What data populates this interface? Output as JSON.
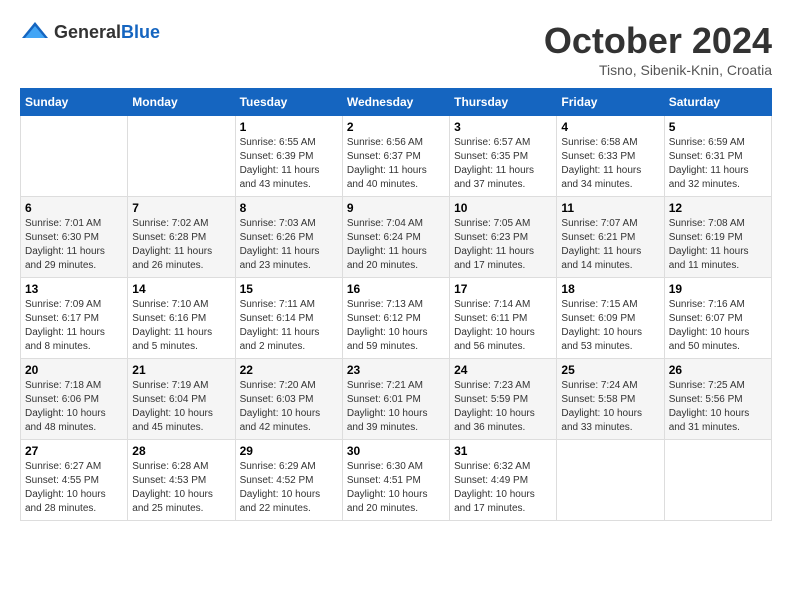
{
  "header": {
    "logo_general": "General",
    "logo_blue": "Blue",
    "month_year": "October 2024",
    "location": "Tisno, Sibenik-Knin, Croatia"
  },
  "weekdays": [
    "Sunday",
    "Monday",
    "Tuesday",
    "Wednesday",
    "Thursday",
    "Friday",
    "Saturday"
  ],
  "weeks": [
    [
      {
        "day": "",
        "info": ""
      },
      {
        "day": "",
        "info": ""
      },
      {
        "day": "1",
        "info": "Sunrise: 6:55 AM\nSunset: 6:39 PM\nDaylight: 11 hours and 43 minutes."
      },
      {
        "day": "2",
        "info": "Sunrise: 6:56 AM\nSunset: 6:37 PM\nDaylight: 11 hours and 40 minutes."
      },
      {
        "day": "3",
        "info": "Sunrise: 6:57 AM\nSunset: 6:35 PM\nDaylight: 11 hours and 37 minutes."
      },
      {
        "day": "4",
        "info": "Sunrise: 6:58 AM\nSunset: 6:33 PM\nDaylight: 11 hours and 34 minutes."
      },
      {
        "day": "5",
        "info": "Sunrise: 6:59 AM\nSunset: 6:31 PM\nDaylight: 11 hours and 32 minutes."
      }
    ],
    [
      {
        "day": "6",
        "info": "Sunrise: 7:01 AM\nSunset: 6:30 PM\nDaylight: 11 hours and 29 minutes."
      },
      {
        "day": "7",
        "info": "Sunrise: 7:02 AM\nSunset: 6:28 PM\nDaylight: 11 hours and 26 minutes."
      },
      {
        "day": "8",
        "info": "Sunrise: 7:03 AM\nSunset: 6:26 PM\nDaylight: 11 hours and 23 minutes."
      },
      {
        "day": "9",
        "info": "Sunrise: 7:04 AM\nSunset: 6:24 PM\nDaylight: 11 hours and 20 minutes."
      },
      {
        "day": "10",
        "info": "Sunrise: 7:05 AM\nSunset: 6:23 PM\nDaylight: 11 hours and 17 minutes."
      },
      {
        "day": "11",
        "info": "Sunrise: 7:07 AM\nSunset: 6:21 PM\nDaylight: 11 hours and 14 minutes."
      },
      {
        "day": "12",
        "info": "Sunrise: 7:08 AM\nSunset: 6:19 PM\nDaylight: 11 hours and 11 minutes."
      }
    ],
    [
      {
        "day": "13",
        "info": "Sunrise: 7:09 AM\nSunset: 6:17 PM\nDaylight: 11 hours and 8 minutes."
      },
      {
        "day": "14",
        "info": "Sunrise: 7:10 AM\nSunset: 6:16 PM\nDaylight: 11 hours and 5 minutes."
      },
      {
        "day": "15",
        "info": "Sunrise: 7:11 AM\nSunset: 6:14 PM\nDaylight: 11 hours and 2 minutes."
      },
      {
        "day": "16",
        "info": "Sunrise: 7:13 AM\nSunset: 6:12 PM\nDaylight: 10 hours and 59 minutes."
      },
      {
        "day": "17",
        "info": "Sunrise: 7:14 AM\nSunset: 6:11 PM\nDaylight: 10 hours and 56 minutes."
      },
      {
        "day": "18",
        "info": "Sunrise: 7:15 AM\nSunset: 6:09 PM\nDaylight: 10 hours and 53 minutes."
      },
      {
        "day": "19",
        "info": "Sunrise: 7:16 AM\nSunset: 6:07 PM\nDaylight: 10 hours and 50 minutes."
      }
    ],
    [
      {
        "day": "20",
        "info": "Sunrise: 7:18 AM\nSunset: 6:06 PM\nDaylight: 10 hours and 48 minutes."
      },
      {
        "day": "21",
        "info": "Sunrise: 7:19 AM\nSunset: 6:04 PM\nDaylight: 10 hours and 45 minutes."
      },
      {
        "day": "22",
        "info": "Sunrise: 7:20 AM\nSunset: 6:03 PM\nDaylight: 10 hours and 42 minutes."
      },
      {
        "day": "23",
        "info": "Sunrise: 7:21 AM\nSunset: 6:01 PM\nDaylight: 10 hours and 39 minutes."
      },
      {
        "day": "24",
        "info": "Sunrise: 7:23 AM\nSunset: 5:59 PM\nDaylight: 10 hours and 36 minutes."
      },
      {
        "day": "25",
        "info": "Sunrise: 7:24 AM\nSunset: 5:58 PM\nDaylight: 10 hours and 33 minutes."
      },
      {
        "day": "26",
        "info": "Sunrise: 7:25 AM\nSunset: 5:56 PM\nDaylight: 10 hours and 31 minutes."
      }
    ],
    [
      {
        "day": "27",
        "info": "Sunrise: 6:27 AM\nSunset: 4:55 PM\nDaylight: 10 hours and 28 minutes."
      },
      {
        "day": "28",
        "info": "Sunrise: 6:28 AM\nSunset: 4:53 PM\nDaylight: 10 hours and 25 minutes."
      },
      {
        "day": "29",
        "info": "Sunrise: 6:29 AM\nSunset: 4:52 PM\nDaylight: 10 hours and 22 minutes."
      },
      {
        "day": "30",
        "info": "Sunrise: 6:30 AM\nSunset: 4:51 PM\nDaylight: 10 hours and 20 minutes."
      },
      {
        "day": "31",
        "info": "Sunrise: 6:32 AM\nSunset: 4:49 PM\nDaylight: 10 hours and 17 minutes."
      },
      {
        "day": "",
        "info": ""
      },
      {
        "day": "",
        "info": ""
      }
    ]
  ]
}
